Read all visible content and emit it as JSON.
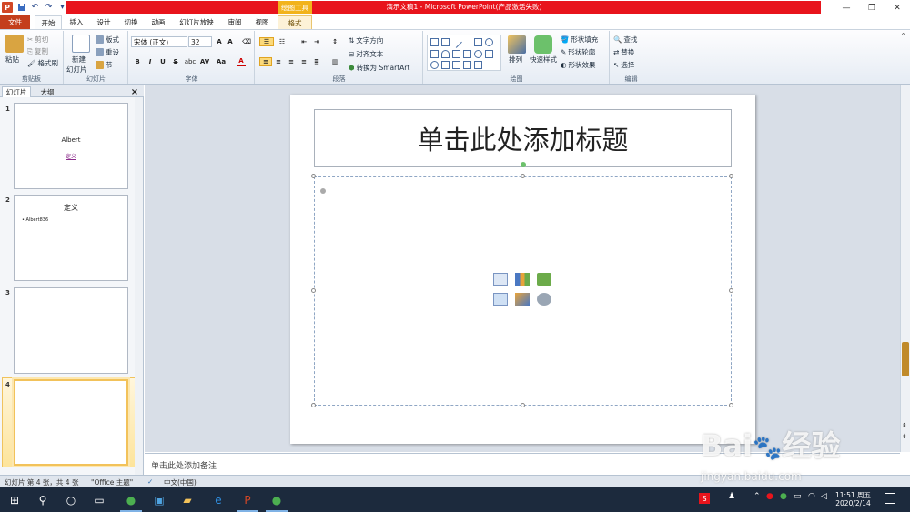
{
  "titlebar": {
    "app_title": "演示文稿1 - Microsoft PowerPoint(产品激活失败)",
    "contextual_tab": "绘图工具",
    "qat": {
      "logo": "P"
    }
  },
  "tabs": [
    {
      "label": "文件"
    },
    {
      "label": "开始"
    },
    {
      "label": "插入"
    },
    {
      "label": "设计"
    },
    {
      "label": "切换"
    },
    {
      "label": "动画"
    },
    {
      "label": "幻灯片放映"
    },
    {
      "label": "审阅"
    },
    {
      "label": "视图"
    },
    {
      "label": "格式"
    }
  ],
  "ribbon": {
    "clipboard": {
      "paste": "粘贴",
      "cut": "剪切",
      "copy": "复制",
      "format_painter": "格式刷",
      "label": "剪贴板"
    },
    "slides": {
      "new_slide": "新建",
      "new_slide2": "幻灯片",
      "layout": "版式",
      "reset": "重设",
      "section": "节",
      "label": "幻灯片"
    },
    "font": {
      "font_name": "宋体 (正文)",
      "font_size": "32",
      "label": "字体",
      "bold": "B",
      "italic": "I",
      "underline": "U",
      "strike": "S",
      "shadow": "abc"
    },
    "paragraph": {
      "text_direction": "文字方向",
      "align_text": "对齐文本",
      "smartart": "转换为 SmartArt",
      "label": "段落"
    },
    "drawing": {
      "arrange": "排列",
      "quick_styles": "快速样式",
      "shape_fill": "形状填充",
      "shape_outline": "形状轮廓",
      "shape_effects": "形状效果",
      "label": "绘图"
    },
    "editing": {
      "find": "查找",
      "replace": "替换",
      "select": "选择",
      "label": "编辑"
    }
  },
  "left_panel": {
    "tab_slides": "幻灯片",
    "tab_outline": "大纲",
    "close": "×",
    "thumbnails": [
      {
        "num": "1",
        "title": "Albert",
        "sub": "定义"
      },
      {
        "num": "2",
        "title": "定义",
        "bullet": "Albert836"
      },
      {
        "num": "3"
      },
      {
        "num": "4"
      }
    ]
  },
  "slide": {
    "title_placeholder": "单击此处添加标题"
  },
  "notes": {
    "placeholder": "单击此处添加备注"
  },
  "status": {
    "slide_info": "幻灯片 第 4 张，共 4 张",
    "theme": "\"Office 主题\"",
    "language": "中文(中国)"
  },
  "taskbar": {
    "time": "11:51 周五",
    "date": "2020/2/14"
  },
  "watermark": {
    "brand": "Bai",
    "brand2": "经验",
    "url": "jingyan.baidu.com"
  },
  "colors": {
    "accent": "#c43e1c",
    "title_red": "#e8141c",
    "contextual": "#f2b31b"
  }
}
